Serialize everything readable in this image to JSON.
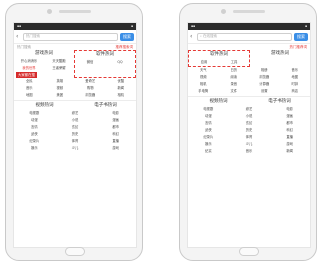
{
  "left": {
    "search": {
      "back": "‹",
      "placeholder": "热门搜索",
      "button": "搜索"
    },
    "history_label": "热门搜索",
    "history_note": "推荐搜索词",
    "sections": {
      "titles": [
        "游戏热词",
        "软件热词"
      ],
      "left_cells": [
        "开心消消乐",
        "天天酷跑",
        "我的世界",
        "王者荣耀",
        "节奏大师",
        "球球大作战"
      ],
      "red_tag": "大家都在搜",
      "soft_cells": [
        "微信",
        "QQ",
        "抖音",
        "快手"
      ],
      "more": [
        "全民",
        "英雄",
        "爱奇艺",
        "优酷",
        "音乐",
        "视频",
        "购物",
        "新闻",
        "地图",
        "美团",
        "浏览器",
        "相机"
      ]
    },
    "bottom_titles": [
      "视频热词",
      "电子书热词"
    ],
    "bottom_cells": [
      "电视剧",
      "综艺",
      "电影",
      "动漫",
      "小说",
      "漫画",
      "言情",
      "玄幻",
      "都市",
      "武侠",
      "历史",
      "科幻",
      "纪录片",
      "体育",
      "直播",
      "娱乐",
      "少儿",
      "游戏"
    ]
  },
  "right": {
    "search": {
      "back": "‹",
      "placeholder": "在线搜索",
      "button": "搜索"
    },
    "note": "热门推荐词",
    "sections": {
      "titles": [
        "软件热词",
        "游戏热词"
      ],
      "soft_top": [
        "应用",
        "工具"
      ],
      "cells": [
        "天气",
        "日历",
        "相册",
        "音乐",
        "视频",
        "阅读",
        "浏览器",
        "地图",
        "相机",
        "录音",
        "计算器",
        "时钟",
        "手电筒",
        "文件",
        "设置",
        "商店",
        "钱包",
        "邮件"
      ]
    },
    "bottom_titles": [
      "视频热词",
      "电子书热词"
    ],
    "bottom_cells": [
      "电视剧",
      "综艺",
      "电影",
      "动漫",
      "小说",
      "漫画",
      "言情",
      "玄幻",
      "都市",
      "武侠",
      "历史",
      "科幻",
      "纪录片",
      "体育",
      "直播",
      "娱乐",
      "少儿",
      "游戏",
      "纪实",
      "音乐",
      "新闻",
      "财经"
    ]
  }
}
